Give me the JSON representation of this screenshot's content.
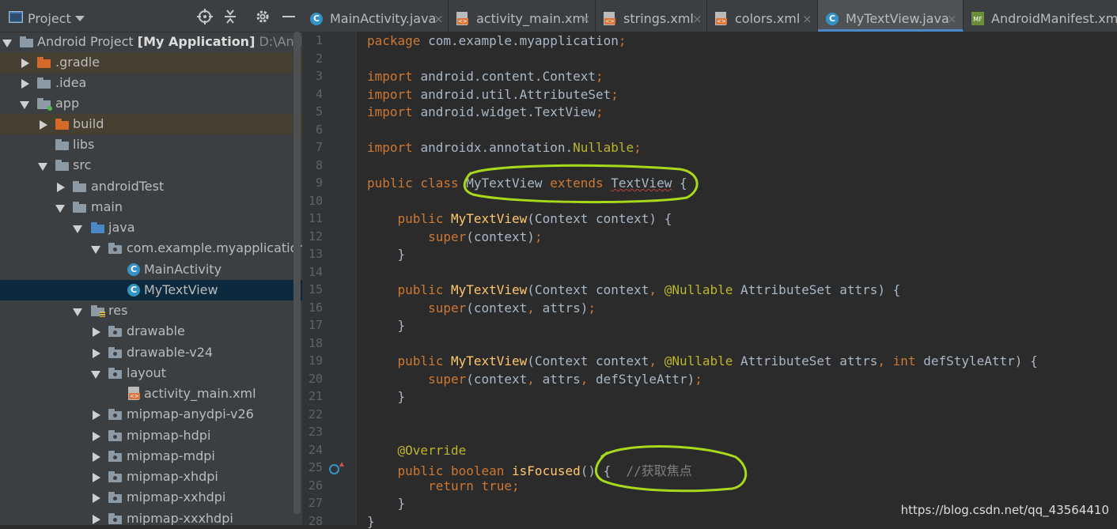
{
  "project_panel": {
    "title": "Project",
    "tree": [
      {
        "label": "Android Project",
        "bold": "[My Application]",
        "path": "D:\\Android"
      },
      {
        "label": ".gradle"
      },
      {
        "label": ".idea"
      },
      {
        "label": "app"
      },
      {
        "label": "build"
      },
      {
        "label": "libs"
      },
      {
        "label": "src"
      },
      {
        "label": "androidTest"
      },
      {
        "label": "main"
      },
      {
        "label": "java"
      },
      {
        "label": "com.example.myapplication"
      },
      {
        "label": "MainActivity"
      },
      {
        "label": "MyTextView"
      },
      {
        "label": "res"
      },
      {
        "label": "drawable"
      },
      {
        "label": "drawable-v24"
      },
      {
        "label": "layout"
      },
      {
        "label": "activity_main.xml"
      },
      {
        "label": "mipmap-anydpi-v26"
      },
      {
        "label": "mipmap-hdpi"
      },
      {
        "label": "mipmap-mdpi"
      },
      {
        "label": "mipmap-xhdpi"
      },
      {
        "label": "mipmap-xxhdpi"
      },
      {
        "label": "mipmap-xxxhdpi"
      }
    ]
  },
  "tabs": [
    {
      "label": "MainActivity.java"
    },
    {
      "label": "activity_main.xml"
    },
    {
      "label": "strings.xml"
    },
    {
      "label": "colors.xml"
    },
    {
      "label": "MyTextView.java"
    },
    {
      "label": "AndroidManifest.xml"
    }
  ],
  "editor": {
    "line_numbers": [
      "1",
      "2",
      "3",
      "4",
      "5",
      "6",
      "7",
      "8",
      "9",
      "10",
      "11",
      "12",
      "13",
      "14",
      "15",
      "16",
      "17",
      "18",
      "19",
      "20",
      "21",
      "22",
      "23",
      "24",
      "25",
      "26",
      "27",
      "28"
    ],
    "lines": [
      [
        [
          "package ",
          "kw"
        ],
        [
          "com.example.myapplication",
          ""
        ],
        [
          ";",
          "kw"
        ]
      ],
      [],
      [
        [
          "import ",
          "kw"
        ],
        [
          "android.content.Context",
          ""
        ],
        [
          ";",
          "kw"
        ]
      ],
      [
        [
          "import ",
          "kw"
        ],
        [
          "android.util.AttributeSet",
          ""
        ],
        [
          ";",
          "kw"
        ]
      ],
      [
        [
          "import ",
          "kw"
        ],
        [
          "android.widget.TextView",
          ""
        ],
        [
          ";",
          "kw"
        ]
      ],
      [],
      [
        [
          "import ",
          "kw"
        ],
        [
          "androidx.annotation.",
          ""
        ],
        [
          "Nullable",
          "an"
        ],
        [
          ";",
          "kw"
        ]
      ],
      [],
      [
        [
          "public class ",
          "kw"
        ],
        [
          "MyTextView ",
          ""
        ],
        [
          "extends ",
          "kw"
        ],
        [
          "TextView",
          "err"
        ],
        [
          " {",
          ""
        ]
      ],
      [],
      [
        [
          "    public ",
          "kw"
        ],
        [
          "MyTextView",
          "fn"
        ],
        [
          "(Context context) {",
          ""
        ]
      ],
      [
        [
          "        super",
          "kw"
        ],
        [
          "(context)",
          ""
        ],
        [
          ";",
          "kw"
        ]
      ],
      [
        [
          "    }",
          ""
        ]
      ],
      [],
      [
        [
          "    public ",
          "kw"
        ],
        [
          "MyTextView",
          "fn"
        ],
        [
          "(Context context",
          ""
        ],
        [
          ", ",
          "kw"
        ],
        [
          "@Nullable ",
          "an"
        ],
        [
          "AttributeSet attrs) {",
          ""
        ]
      ],
      [
        [
          "        super",
          "kw"
        ],
        [
          "(context",
          ""
        ],
        [
          ", ",
          "kw"
        ],
        [
          "attrs)",
          ""
        ],
        [
          ";",
          "kw"
        ]
      ],
      [
        [
          "    }",
          ""
        ]
      ],
      [],
      [
        [
          "    public ",
          "kw"
        ],
        [
          "MyTextView",
          "fn"
        ],
        [
          "(Context context",
          ""
        ],
        [
          ", ",
          "kw"
        ],
        [
          "@Nullable ",
          "an"
        ],
        [
          "AttributeSet attrs",
          ""
        ],
        [
          ", ",
          "kw"
        ],
        [
          "int ",
          "kw"
        ],
        [
          "defStyleAttr) {",
          ""
        ]
      ],
      [
        [
          "        super",
          "kw"
        ],
        [
          "(context",
          ""
        ],
        [
          ", ",
          "kw"
        ],
        [
          "attrs",
          ""
        ],
        [
          ", ",
          "kw"
        ],
        [
          "defStyleAttr)",
          ""
        ],
        [
          ";",
          "kw"
        ]
      ],
      [
        [
          "    }",
          ""
        ]
      ],
      [],
      [],
      [
        [
          "    @Override",
          "an"
        ]
      ],
      [
        [
          "    public boolean ",
          "kw"
        ],
        [
          "isFocused",
          "fn"
        ],
        [
          "() {  ",
          ""
        ],
        [
          "//获取焦点",
          "cm"
        ]
      ],
      [
        [
          "        return true",
          "kw"
        ],
        [
          ";",
          "kw"
        ]
      ],
      [
        [
          "    }",
          ""
        ]
      ],
      [
        [
          "}",
          ""
        ]
      ]
    ]
  },
  "watermark": "https://blog.csdn.net/qq_43564410",
  "colors": {
    "keyword": "#cc7832",
    "function": "#ffc66d",
    "annotation": "#bbb529",
    "comment": "#808080",
    "default_text": "#a9b7c6",
    "highlight_marker": "#a8d91a"
  }
}
